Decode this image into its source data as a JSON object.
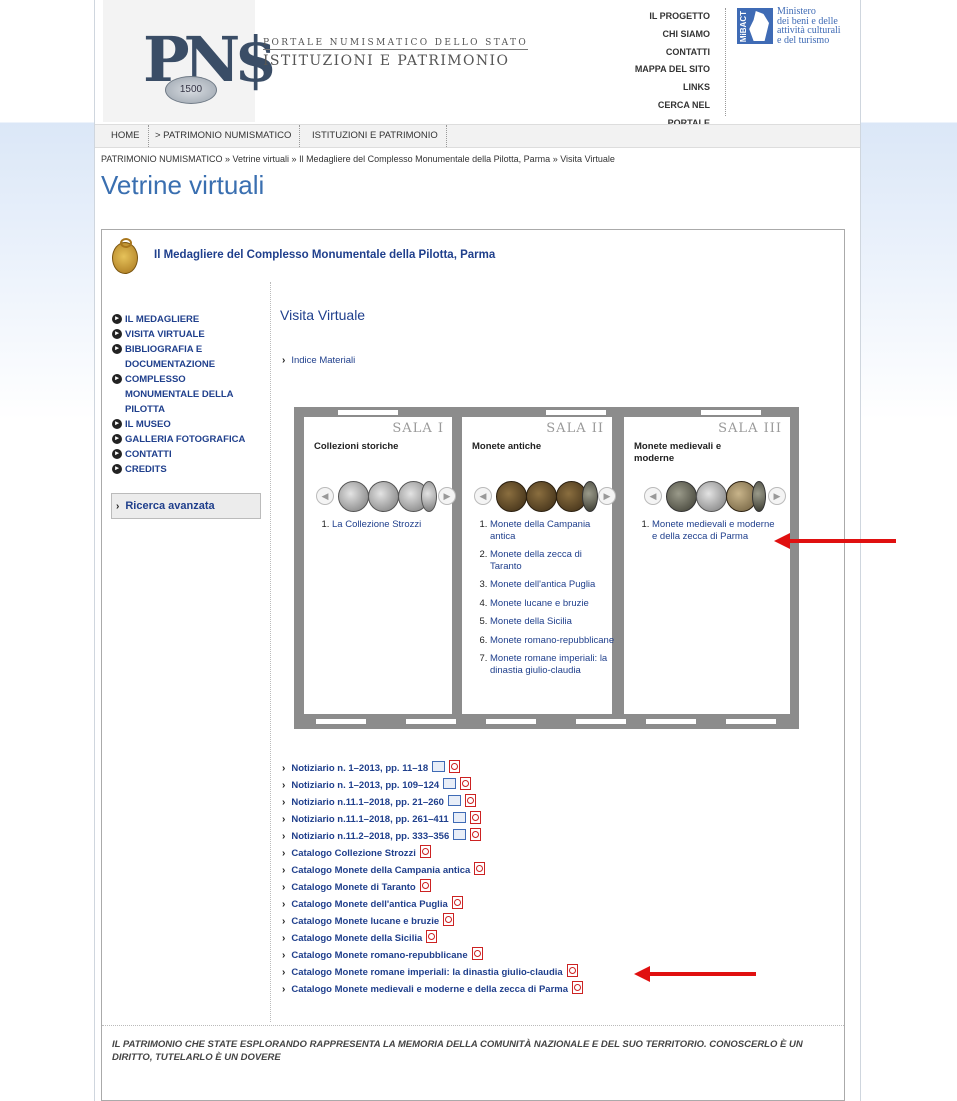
{
  "header": {
    "logo_coin_text": "1500",
    "portal_small": "PORTALE NUMISMATICO DELLO STATO",
    "portal_big": "ISTITUZIONI E PATRIMONIO",
    "topnav": [
      "IL PROGETTO",
      "CHI SIAMO",
      "CONTATTI",
      "MAPPA DEL SITO",
      "LINKS",
      "CERCA NEL",
      "PORTALE"
    ],
    "mibac_mark": "MiBACT",
    "mibac_text": [
      "Ministero",
      "dei beni e delle",
      "attività culturali",
      "e del turismo"
    ]
  },
  "menubar": [
    "HOME",
    "> PATRIMONIO NUMISMATICO",
    "ISTITUZIONI E PATRIMONIO"
  ],
  "breadcrumb": {
    "items": [
      "PATRIMONIO NUMISMATICO",
      "Vetrine virtuali",
      "Il Medagliere del Complesso Monumentale della Pilotta, Parma",
      "Visita Virtuale"
    ],
    "sep": " » "
  },
  "page_title": "Vetrine virtuali",
  "section_title": "Il Medagliere del Complesso Monumentale della Pilotta, Parma",
  "sidebar": {
    "items": [
      "IL MEDAGLIERE",
      "VISITA VIRTUALE",
      "BIBLIOGRAFIA E DOCUMENTAZIONE",
      "COMPLESSO MONUMENTALE DELLA PILOTTA",
      "IL MUSEO",
      "GALLERIA FOTOGRAFICA",
      "CONTATTI",
      "CREDITS"
    ],
    "search_label": "Ricerca avanzata"
  },
  "content": {
    "title": "Visita Virtuale",
    "index_link": "Indice Materiali"
  },
  "rooms": [
    {
      "label": "SALA I",
      "title": "Collezioni storiche",
      "items": [
        "La Collezione Strozzi"
      ]
    },
    {
      "label": "SALA II",
      "title": "Monete antiche",
      "items": [
        "Monete della Campania antica",
        "Monete della zecca di Taranto",
        "Monete dell'antica Puglia",
        "Monete lucane e bruzie",
        "Monete della Sicilia",
        "Monete romano-repubblicane",
        "Monete romane imperiali: la dinastia giulio-claudia"
      ]
    },
    {
      "label": "SALA III",
      "title": "Monete medievali e moderne",
      "items": [
        "Monete medievali e moderne e della zecca di Parma"
      ]
    }
  ],
  "publications": [
    {
      "label": "Notiziario n. 1–2013, pp. 11–18",
      "book": true
    },
    {
      "label": "Notiziario n. 1–2013, pp. 109–124",
      "book": true
    },
    {
      "label": "Notiziario n.11.1–2018, pp. 21–260",
      "book": true
    },
    {
      "label": "Notiziario n.11.1–2018, pp. 261–411",
      "book": true
    },
    {
      "label": "Notiziario n.11.2–2018, pp. 333–356",
      "book": true
    },
    {
      "label": "Catalogo Collezione Strozzi",
      "book": false
    },
    {
      "label": "Catalogo Monete della Campania antica",
      "book": false
    },
    {
      "label": "Catalogo Monete di Taranto",
      "book": false
    },
    {
      "label": "Catalogo Monete dell'antica Puglia",
      "book": false
    },
    {
      "label": "Catalogo Monete lucane e bruzie",
      "book": false
    },
    {
      "label": "Catalogo Monete della Sicilia",
      "book": false
    },
    {
      "label": "Catalogo Monete romano-repubblicane",
      "book": false
    },
    {
      "label": "Catalogo Monete romane imperiali: la dinastia giulio-claudia",
      "book": false
    },
    {
      "label": "Catalogo Monete medievali e moderne e della zecca di Parma",
      "book": false
    }
  ],
  "footer": "IL PATRIMONIO CHE STATE ESPLORANDO RAPPRESENTA LA MEMORIA DELLA COMUNITÀ NAZIONALE E DEL SUO TERRITORIO. CONOSCERLO È UN DIRITTO, TUTELARLO È UN DOVERE",
  "colors": {
    "link": "#1f3f8c",
    "title": "#3a6fb0",
    "annotation_arrow": "#e01010"
  }
}
